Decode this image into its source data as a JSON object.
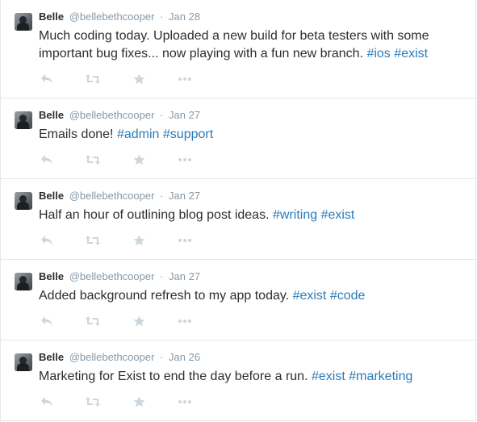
{
  "colors": {
    "text": "#292f33",
    "meta": "#8899a6",
    "hashtag": "#2b7bb9",
    "action_icon": "#ccd6dd",
    "divider": "#e1e8ed"
  },
  "action_icons": [
    "reply-icon",
    "retweet-icon",
    "favorite-icon",
    "more-icon"
  ],
  "tweets": [
    {
      "name": "Belle",
      "handle": "@bellebethcooper",
      "separator": "·",
      "date": "Jan 28",
      "body": "Much coding today. Uploaded a new build for beta testers with some important bug fixes... now playing with a fun new branch.",
      "hashtags": [
        "#ios",
        "#exist"
      ]
    },
    {
      "name": "Belle",
      "handle": "@bellebethcooper",
      "separator": "·",
      "date": "Jan 27",
      "body": "Emails done!",
      "hashtags": [
        "#admin",
        "#support"
      ]
    },
    {
      "name": "Belle",
      "handle": "@bellebethcooper",
      "separator": "·",
      "date": "Jan 27",
      "body": "Half an hour of outlining blog post ideas.",
      "hashtags": [
        "#writing",
        "#exist"
      ]
    },
    {
      "name": "Belle",
      "handle": "@bellebethcooper",
      "separator": "·",
      "date": "Jan 27",
      "body": "Added background refresh to my app today.",
      "hashtags": [
        "#exist",
        "#code"
      ]
    },
    {
      "name": "Belle",
      "handle": "@bellebethcooper",
      "separator": "·",
      "date": "Jan 26",
      "body": "Marketing for Exist to end the day before a run.",
      "hashtags": [
        "#exist",
        "#marketing"
      ]
    }
  ]
}
